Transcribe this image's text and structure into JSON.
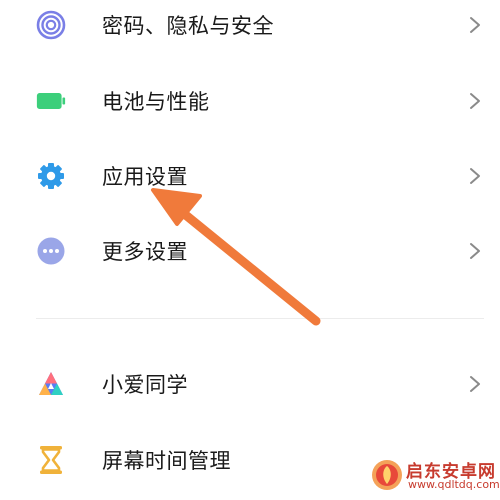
{
  "settings": {
    "items": [
      {
        "label": "密码、隐私与安全",
        "icon": "fingerprint-icon",
        "color": "#7a7fe6"
      },
      {
        "label": "电池与性能",
        "icon": "battery-icon",
        "color": "#3ccf7b"
      },
      {
        "label": "应用设置",
        "icon": "gear-icon",
        "color": "#2f9ae8"
      },
      {
        "label": "更多设置",
        "icon": "more-dots-icon",
        "color": "#9aa6e8"
      },
      {
        "label": "小爱同学",
        "icon": "xiaoai-icon",
        "color": "#5b7cf5"
      },
      {
        "label": "屏幕时间管理",
        "icon": "hourglass-icon",
        "color": "#f0b23a"
      }
    ]
  },
  "annotation": {
    "arrow_color": "#f07a3b"
  },
  "watermark": {
    "title": "启东安卓网",
    "url": "www.qdltdq.com",
    "color": "#c73b2e"
  }
}
